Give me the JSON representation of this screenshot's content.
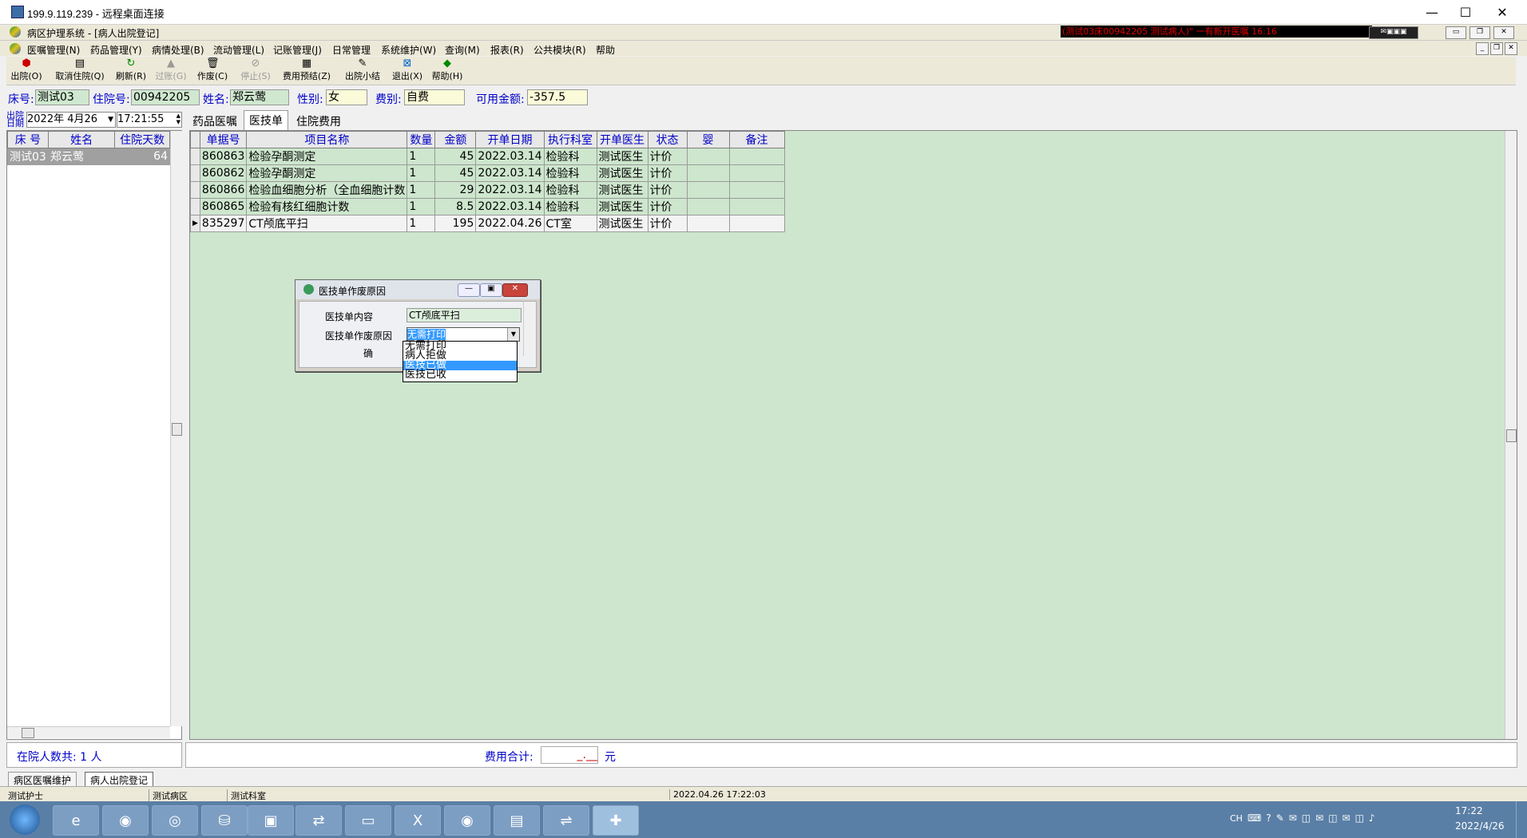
{
  "rdp": {
    "title": "199.9.119.239 - 远程桌面连接"
  },
  "app": {
    "title": "病区护理系统 - [病人出院登记]",
    "notice": "(测试03床00942205 测试病人)\" 一有新开医嘱 16:16"
  },
  "menu": [
    "医嘱管理(N)",
    "药品管理(Y)",
    "病情处理(B)",
    "流动管理(L)",
    "记账管理(J)",
    "日常管理",
    "系统维护(W)",
    "查询(M)",
    "报表(R)",
    "公共模块(R)",
    "帮助"
  ],
  "toolbar": [
    {
      "label": "出院(O)",
      "icon": "discharge-icon",
      "enabled": true
    },
    {
      "label": "取消住院(Q)",
      "icon": "cancel-admission-icon",
      "enabled": true
    },
    {
      "label": "刷新(R)",
      "icon": "refresh-icon",
      "enabled": true
    },
    {
      "label": "过账(G)",
      "icon": "post-icon",
      "enabled": false
    },
    {
      "label": "作废(C)",
      "icon": "trash-icon",
      "enabled": true
    },
    {
      "label": "停止(S)",
      "icon": "stop-icon",
      "enabled": false
    },
    {
      "label": "费用预结(Z)",
      "icon": "calc-icon",
      "enabled": true
    },
    {
      "label": "出院小结",
      "icon": "pen-icon",
      "enabled": true
    },
    {
      "label": "退出(X)",
      "icon": "exit-icon",
      "enabled": true
    },
    {
      "label": "帮助(H)",
      "icon": "help-icon",
      "enabled": true
    }
  ],
  "patient": {
    "bed_label": "床号:",
    "bed": "测试03",
    "admission_label": "住院号:",
    "admission": "00942205",
    "name_label": "姓名:",
    "name": "郑云莺",
    "sex_label": "性别:",
    "sex": "女",
    "fee_type_label": "费别:",
    "fee_type": "自费",
    "balance_label": "可用金额:",
    "balance": "-357.5"
  },
  "discharge_date": {
    "label": "出院日期",
    "date": "2022年 4月26",
    "time": "17:21:55"
  },
  "tabs": [
    "药品医嘱",
    "医技单",
    "住院费用"
  ],
  "active_tab": "医技单",
  "left_table": {
    "headers": [
      "床 号",
      "姓名",
      "住院天数"
    ],
    "rows": [
      [
        "测试03",
        "郑云莺",
        "64"
      ]
    ]
  },
  "main_table": {
    "headers": [
      "单据号",
      "项目名称",
      "数量",
      "金额",
      "开单日期",
      "执行科室",
      "开单医生",
      "状态",
      "婴",
      "备注"
    ],
    "rows": [
      [
        "860863",
        "检验孕酮测定",
        "1",
        "45",
        "2022.03.14",
        "检验科",
        "测试医生",
        "计价",
        "",
        ""
      ],
      [
        "860862",
        "检验孕酮测定",
        "1",
        "45",
        "2022.03.14",
        "检验科",
        "测试医生",
        "计价",
        "",
        ""
      ],
      [
        "860866",
        "检验血细胞分析（全血细胞计数",
        "1",
        "29",
        "2022.03.14",
        "检验科",
        "测试医生",
        "计价",
        "",
        ""
      ],
      [
        "860865",
        "检验有核红细胞计数",
        "1",
        "8.5",
        "2022.03.14",
        "检验科",
        "测试医生",
        "计价",
        "",
        ""
      ],
      [
        "835297",
        "CT颅底平扫",
        "1",
        "195",
        "2022.04.26",
        "CT室",
        "测试医生",
        "计价",
        "",
        ""
      ]
    ]
  },
  "dialog": {
    "title": "医技单作废原因",
    "content_label": "医技单内容",
    "content_value": "CT颅底平扫",
    "reason_label": "医技单作废原因",
    "reason_value": "无需打印",
    "confirm": "确",
    "options": [
      "无需打印",
      "病人拒做",
      "医技已做",
      "医技已收"
    ],
    "selected_index": 2
  },
  "status": {
    "count_text": "在院人数共: 1 人",
    "fee_total_label": "费用合计:",
    "fee_total_value": "_.__",
    "fee_unit": "元"
  },
  "bottom_tabs": [
    "病区医嘱维护",
    "病人出院登记"
  ],
  "strip": {
    "nurse": "测试护士",
    "ward": "测试病区",
    "dept": "测试科室",
    "datetime": "2022.04.26 17:22:03"
  },
  "tray": {
    "lang": "CH",
    "time": "17:22",
    "date": "2022/4/26"
  },
  "taskbar_icons": [
    "windows-start-icon",
    "ie-icon",
    "chrome-icon",
    "media-icon",
    "database-icon",
    "network-icon",
    "rdp-icon",
    "folder-icon",
    "excel-icon",
    "record-icon",
    "notepad-icon",
    "remote-icon",
    "app-icon"
  ]
}
